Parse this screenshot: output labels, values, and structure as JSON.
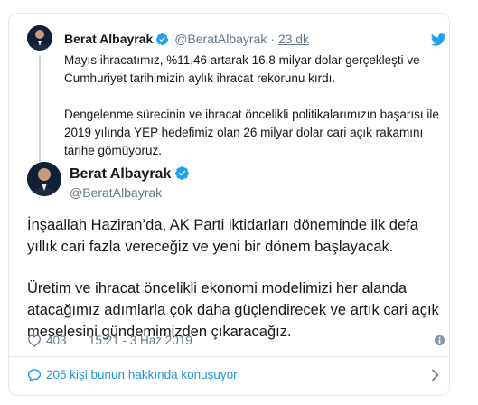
{
  "colors": {
    "text": "#14171a",
    "muted": "#657786",
    "link": "#1b95e0",
    "border": "#e1e8ed",
    "verified": "#1da1f2"
  },
  "quoted_tweet": {
    "author_name": "Berat Albayrak",
    "handle": "@BeratAlbayrak",
    "separator": "·",
    "time": "23 dk",
    "paragraphs": [
      "Mayıs ihracatımız, %11,46 artarak 16,8 milyar dolar gerçekleşti ve Cumhuriyet tarihimizin aylık ihracat rekorunu kırdı.",
      "Dengelenme sürecinin ve ihracat öncelikli politikalarımızın başarısı ile 2019 yılında YEP hedefimiz olan 26 milyar dolar cari açık rakamını tarihe gömüyoruz."
    ],
    "icons": [
      "avatar",
      "verified-badge-icon",
      "twitter-bird-icon"
    ]
  },
  "main_tweet": {
    "author_name": "Berat Albayrak",
    "handle": "@BeratAlbayrak",
    "paragraphs": [
      "İnşaallah Haziran’da, AK Parti iktidarları döneminde ilk defa yıllık cari fazla vereceğiz ve yeni bir dönem başlayacak.",
      "Üretim ve ihracat öncelikli ekonomi modelimizi her alanda atacağımız adımlarla çok daha güçlendirecek ve artık cari açık meselesini gündemimizden çıkaracağız."
    ],
    "like_count": "403",
    "timestamp": "15:21 - 3 Haz 2019",
    "icons": [
      "avatar",
      "verified-badge-icon",
      "heart-icon",
      "info-icon"
    ]
  },
  "conversation": {
    "label": "205 kişi bunun hakkında konuşuyor",
    "icons": [
      "speech-bubble-icon",
      "chevron-right-icon"
    ]
  }
}
